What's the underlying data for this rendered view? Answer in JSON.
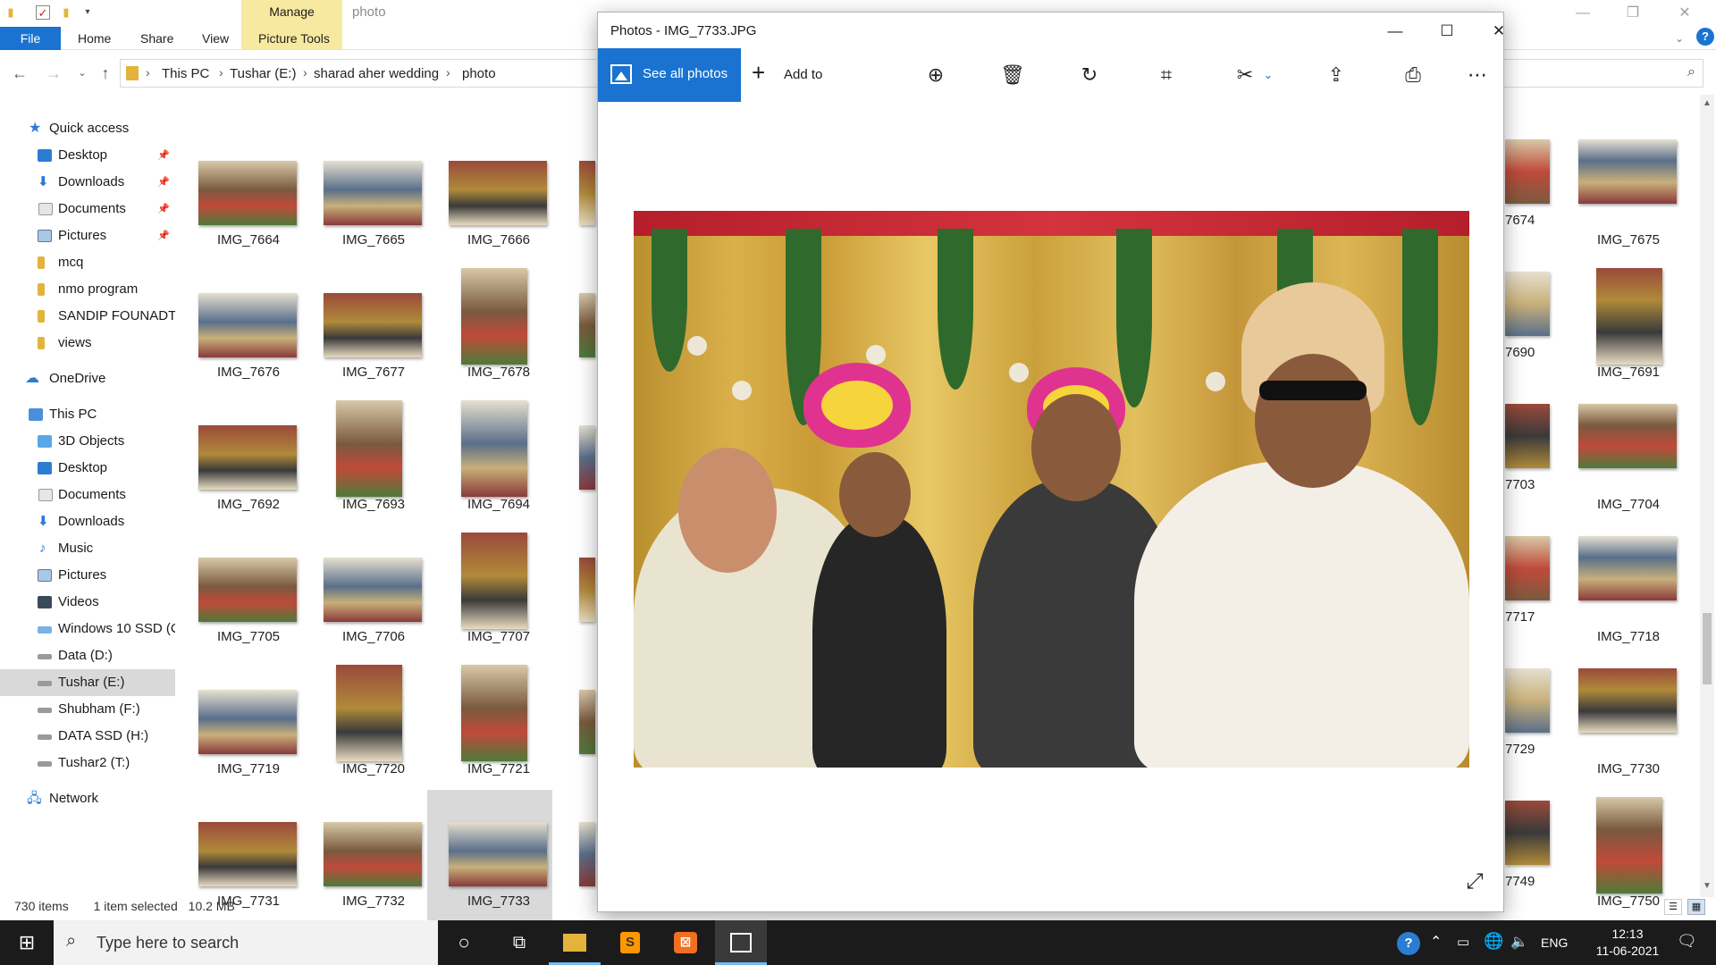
{
  "explorer": {
    "title": "photo",
    "context_tab": "Manage",
    "tabs": [
      "File",
      "Home",
      "Share",
      "View",
      "Picture Tools"
    ],
    "breadcrumb": [
      "This PC",
      "Tushar (E:)",
      "sharad aher wedding",
      "photo"
    ],
    "nav": {
      "quick_access": "Quick access",
      "quick_items": [
        "Desktop",
        "Downloads",
        "Documents",
        "Pictures",
        "mcq",
        "nmo program",
        "SANDIP FOUNADTI(",
        "views"
      ],
      "onedrive": "OneDrive",
      "this_pc": "This PC",
      "pc_items": [
        "3D Objects",
        "Desktop",
        "Documents",
        "Downloads",
        "Music",
        "Pictures",
        "Videos",
        "Windows 10 SSD (C",
        "Data (D:)",
        "Tushar (E:)",
        "Shubham (F:)",
        "DATA SSD (H:)",
        "Tushar2 (T:)"
      ],
      "network": "Network"
    },
    "files_left": [
      [
        "IMG_7664",
        "IMG_7665",
        "IMG_7666"
      ],
      [
        "IMG_7676",
        "IMG_7677",
        "IMG_7678"
      ],
      [
        "IMG_7692",
        "IMG_7693",
        "IMG_7694"
      ],
      [
        "IMG_7705",
        "IMG_7706",
        "IMG_7707"
      ],
      [
        "IMG_7719",
        "IMG_7720",
        "IMG_7721"
      ],
      [
        "IMG_7731",
        "IMG_7732",
        "IMG_7733"
      ]
    ],
    "files_partial": [
      "7674",
      "7690",
      "7703",
      "7717",
      "7729",
      "7749"
    ],
    "files_right": [
      "IMG_7675",
      "IMG_7691",
      "IMG_7704",
      "IMG_7718",
      "IMG_7730",
      "IMG_7750"
    ],
    "status": {
      "count": "730 items",
      "selection": "1 item selected",
      "size": "10.2 MB"
    }
  },
  "photos": {
    "title": "Photos - IMG_7733.JPG",
    "see_all": "See all photos",
    "add_to": "Add to",
    "toolbar_icons": [
      "zoom-in-icon",
      "delete-icon",
      "rotate-icon",
      "crop-icon",
      "edit-icon",
      "share-icon",
      "print-icon",
      "more-icon"
    ]
  },
  "taskbar": {
    "search_placeholder": "Type here to search",
    "language": "ENG",
    "time": "12:13",
    "date": "11-06-2021"
  },
  "colors": {
    "accent": "#1a73d1",
    "context_tab": "#f8e9a0",
    "taskbar": "#1b1b1b"
  }
}
